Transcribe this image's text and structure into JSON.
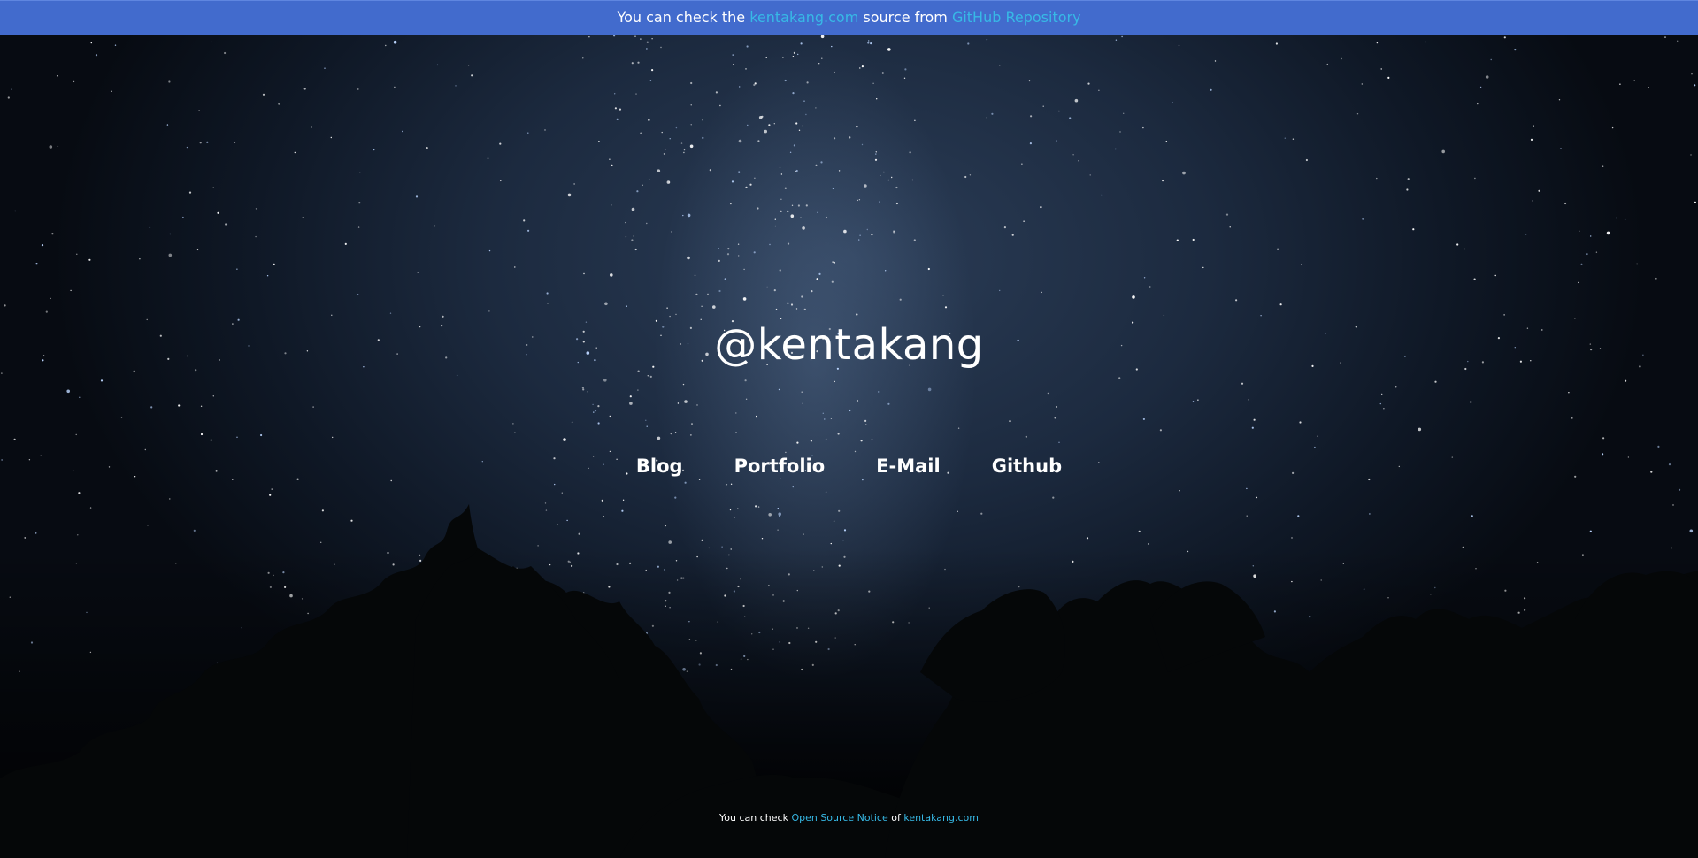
{
  "banner": {
    "prefix": "You can check the ",
    "site_link": "kentakang.com",
    "middle": " source from ",
    "repo_link": "GitHub Repository",
    "background": "#426bcd",
    "link_color": "#37b9e6"
  },
  "main": {
    "title": "@kentakang",
    "nav": [
      {
        "label": "Blog"
      },
      {
        "label": "Portfolio"
      },
      {
        "label": "E-Mail"
      },
      {
        "label": "Github"
      }
    ]
  },
  "footer": {
    "prefix": "You can check ",
    "notice_link": "Open Source Notice",
    "middle": " of ",
    "site_link": "kentakang.com"
  },
  "background": {
    "description_icon": "night-sky-stars-trees"
  }
}
